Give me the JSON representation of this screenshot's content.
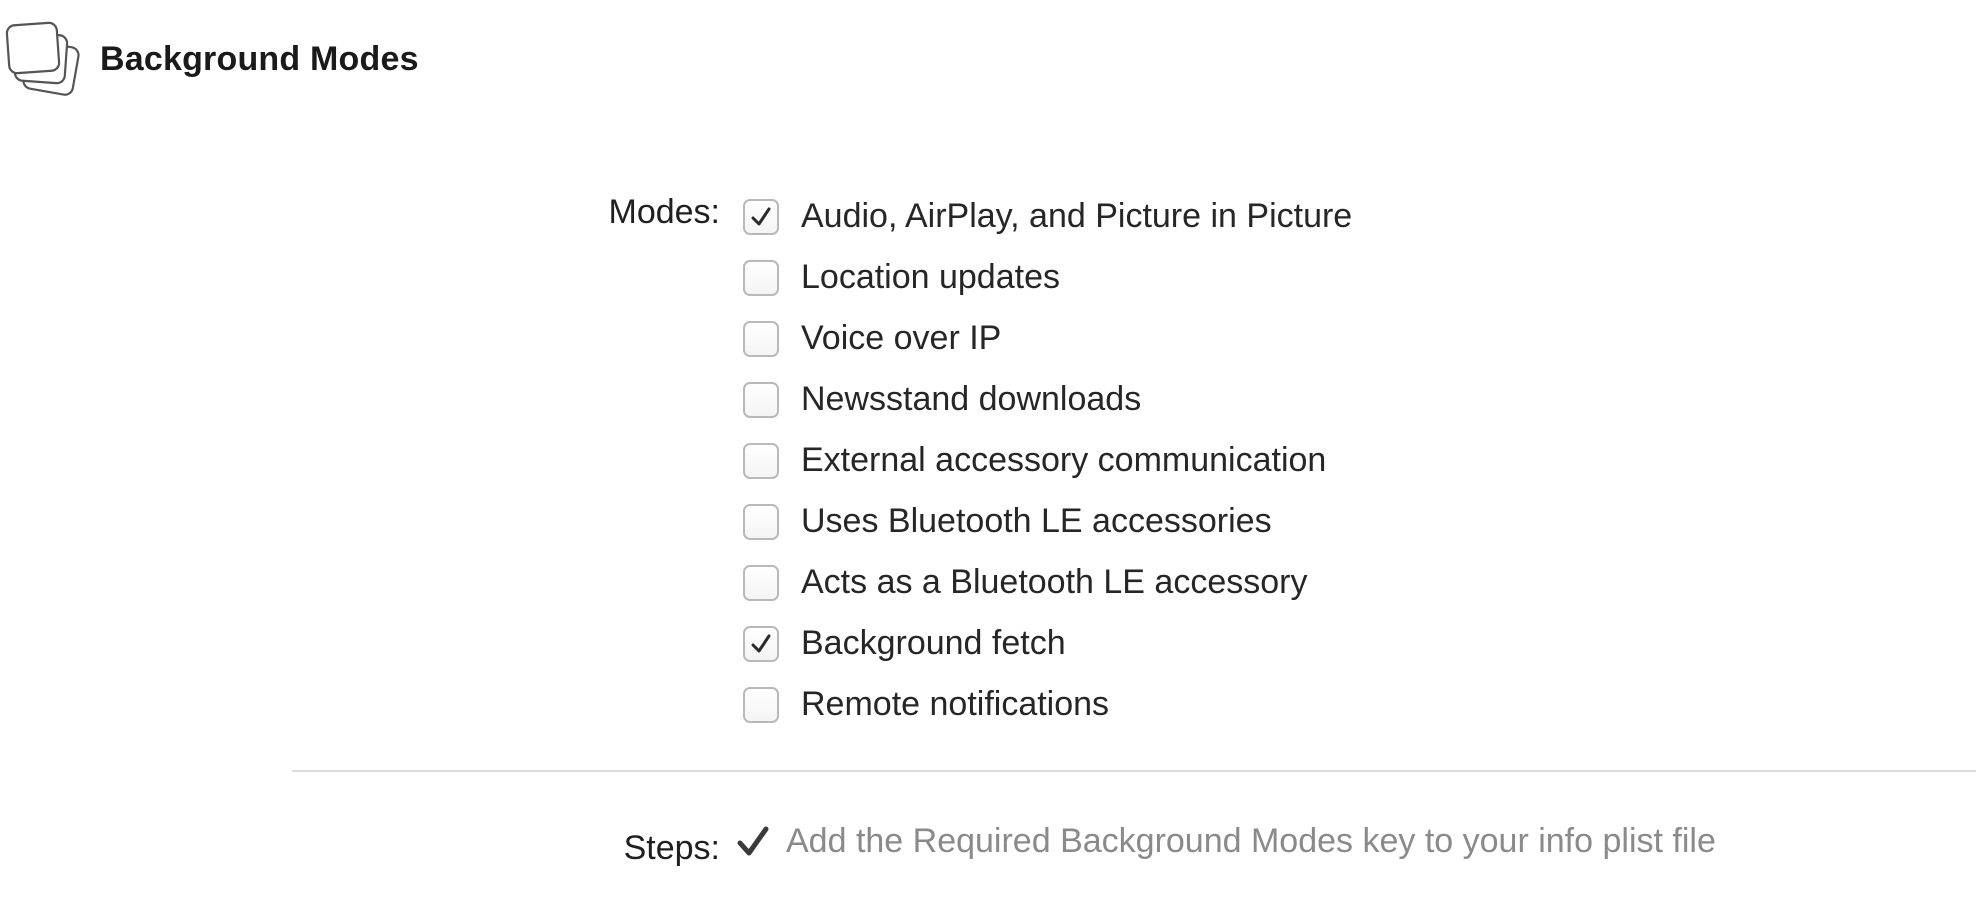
{
  "header": {
    "title": "Background Modes",
    "icon": "background-modes-icon"
  },
  "modes": {
    "label": "Modes:",
    "items": [
      {
        "label": "Audio, AirPlay, and Picture in Picture",
        "checked": true
      },
      {
        "label": "Location updates",
        "checked": false
      },
      {
        "label": "Voice over IP",
        "checked": false
      },
      {
        "label": "Newsstand downloads",
        "checked": false
      },
      {
        "label": "External accessory communication",
        "checked": false
      },
      {
        "label": "Uses Bluetooth LE accessories",
        "checked": false
      },
      {
        "label": "Acts as a Bluetooth LE accessory",
        "checked": false
      },
      {
        "label": "Background fetch",
        "checked": true
      },
      {
        "label": "Remote notifications",
        "checked": false
      }
    ]
  },
  "steps": {
    "label": "Steps:",
    "items": [
      {
        "text": "Add the Required Background Modes key to your info plist file",
        "done": true
      }
    ]
  },
  "colors": {
    "step_text": "#8a8a8a",
    "checkbox_border": "#b9b9b9",
    "divider": "#dcdcdc"
  }
}
